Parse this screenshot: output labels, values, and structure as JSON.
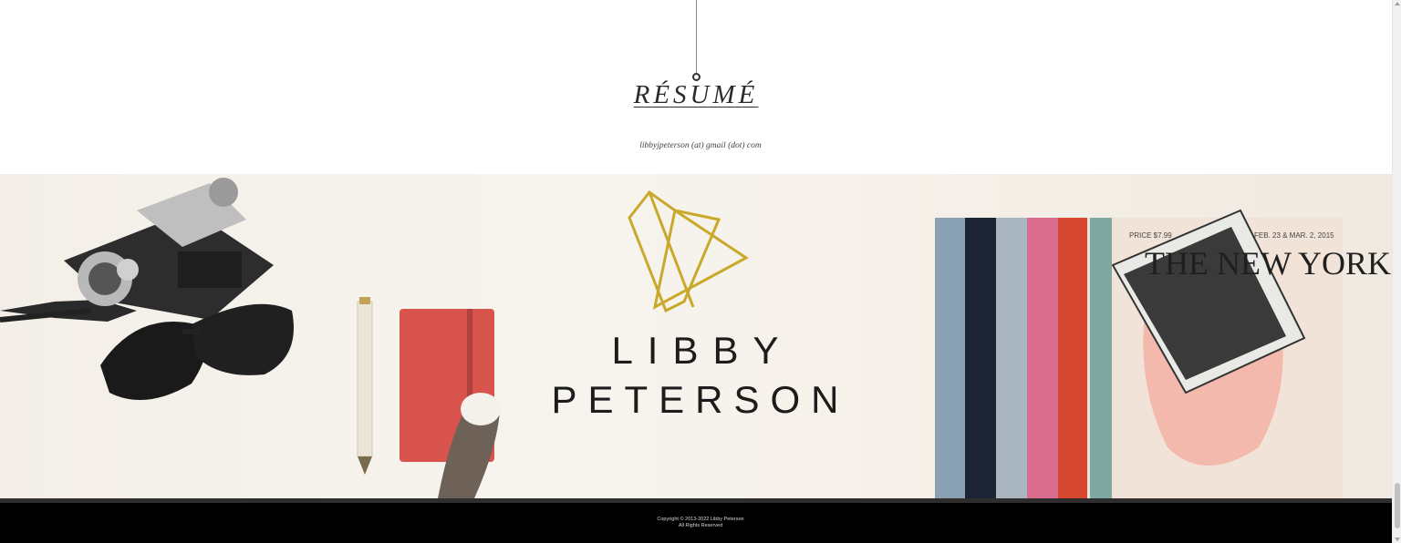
{
  "resume": {
    "heading": "RÉSUMÉ",
    "email": "libbyjpeterson (at) gmail (dot) com"
  },
  "banner": {
    "logo_first": "LIBBY",
    "logo_last": "PETERSON",
    "magazine_title": "THE NEW YORKER",
    "magazine_price": "PRICE $7.99",
    "magazine_date": "FEB. 23 & MAR. 2, 2015"
  },
  "footer": {
    "copyright": "Copyright © 2013-2022 Libby Peterson",
    "rights": "All Rights Reserved"
  },
  "colors": {
    "footer_bg": "#000000",
    "gold_logo": "#c9a92b",
    "notebook_red": "#d8544d"
  }
}
